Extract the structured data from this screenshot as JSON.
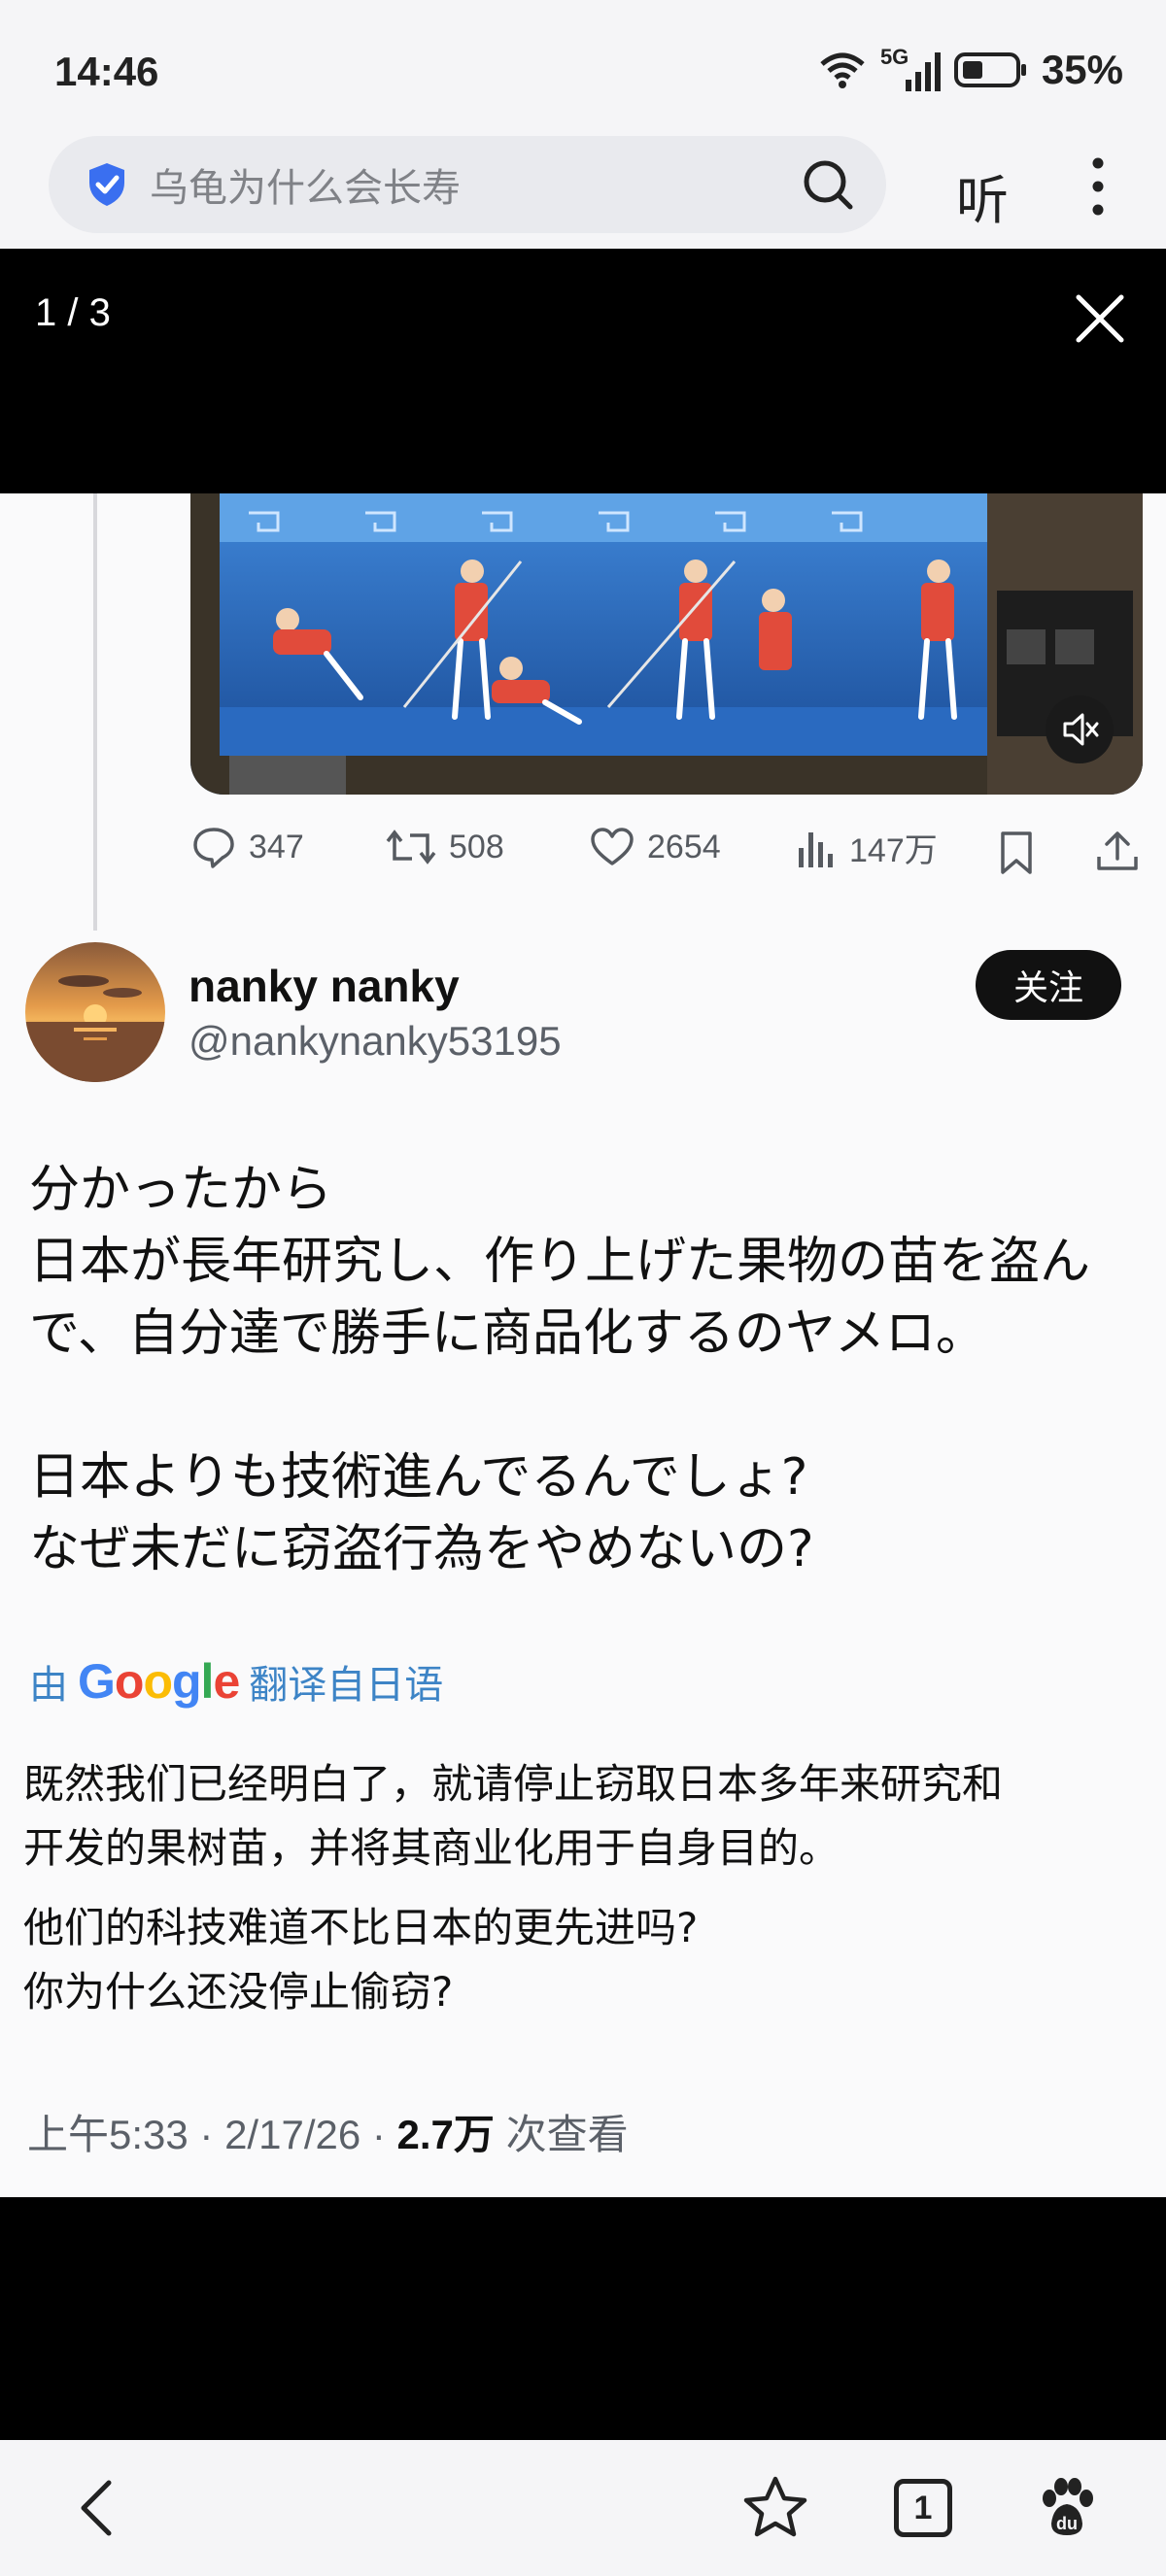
{
  "status_bar": {
    "time": "14:46",
    "network": "5G",
    "battery": "35%"
  },
  "search": {
    "query": "乌龟为什么会长寿",
    "listen_label": "听"
  },
  "viewer": {
    "counter": "1 / 3"
  },
  "post": {
    "stats": {
      "replies": "347",
      "reposts": "508",
      "likes": "2654",
      "views": "147万"
    },
    "author_name": "nanky nanky",
    "author_handle": "@nankynanky53195",
    "follow_label": "关注",
    "original_text": [
      "分かったから",
      "日本が長年研究し、作り上げた果物の苗を盗ん",
      "で、自分達で勝手に商品化するのヤメロ。",
      "",
      "日本よりも技術進んでるんでしょ?",
      "なぜ未だに窃盗行為をやめないの?"
    ],
    "translation_prefix": "由",
    "translation_brand": "Google",
    "translation_suffix": "翻译自日语",
    "translated_paragraph1": [
      "既然我们已经明白了，就请停止窃取日本多年来研究和",
      "开发的果树苗，并将其商业化用于自身目的。"
    ],
    "translated_paragraph2": [
      "他们的科技难道不比日本的更先进吗?",
      "你为什么还没停止偷窃?"
    ],
    "meta_time": "上午5:33 · 2/17/26 · ",
    "meta_views": "2.7万",
    "meta_views_suffix": " 次查看"
  },
  "bottom_nav": {
    "tab_count": "1"
  },
  "colors": {
    "accent_blue": "#3d84c6",
    "shield_blue": "#3a6ff0",
    "text": "#111111",
    "muted": "#5b6068"
  }
}
